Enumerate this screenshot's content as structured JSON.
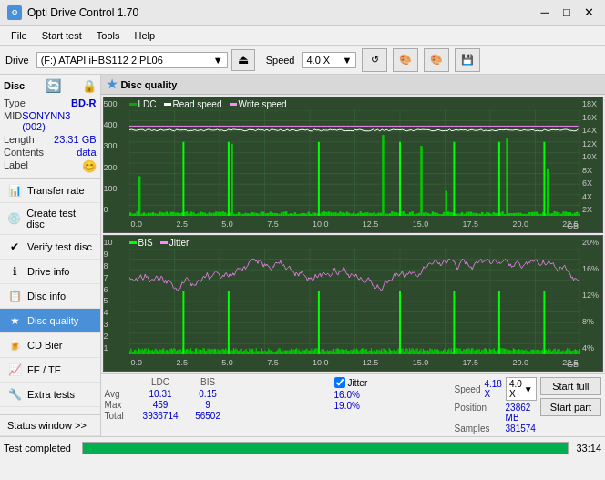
{
  "app": {
    "title": "Opti Drive Control 1.70",
    "icon": "O"
  },
  "titlebar": {
    "minimize": "─",
    "maximize": "□",
    "close": "✕"
  },
  "menubar": {
    "items": [
      "File",
      "Start test",
      "Tools",
      "Help"
    ]
  },
  "toolbar": {
    "drive_label": "Drive",
    "drive_value": "(F:)  ATAPI  iHBS112  2 PL06",
    "speed_label": "Speed",
    "speed_value": "4.0 X"
  },
  "disc": {
    "title": "Disc",
    "type_label": "Type",
    "type_value": "BD-R",
    "mid_label": "MID",
    "mid_value": "SONYNN3 (002)",
    "length_label": "Length",
    "length_value": "23.31 GB",
    "contents_label": "Contents",
    "contents_value": "data",
    "label_label": "Label",
    "label_value": ""
  },
  "nav": {
    "items": [
      {
        "id": "transfer-rate",
        "label": "Transfer rate",
        "icon": "📊"
      },
      {
        "id": "create-test-disc",
        "label": "Create test disc",
        "icon": "💿"
      },
      {
        "id": "verify-test-disc",
        "label": "Verify test disc",
        "icon": "✔"
      },
      {
        "id": "drive-info",
        "label": "Drive info",
        "icon": "ℹ"
      },
      {
        "id": "disc-info",
        "label": "Disc info",
        "icon": "📋"
      },
      {
        "id": "disc-quality",
        "label": "Disc quality",
        "icon": "★",
        "active": true
      },
      {
        "id": "cd-bier",
        "label": "CD Bier",
        "icon": "🍺"
      },
      {
        "id": "fe-te",
        "label": "FE / TE",
        "icon": "📈"
      },
      {
        "id": "extra-tests",
        "label": "Extra tests",
        "icon": "🔧"
      }
    ]
  },
  "quality": {
    "title": "Disc quality",
    "legend": {
      "ldc": "LDC",
      "read_speed": "Read speed",
      "write_speed": "Write speed"
    },
    "chart1": {
      "y_axis": [
        "500",
        "400",
        "300",
        "200",
        "100",
        "0"
      ],
      "y_axis_right": [
        "18X",
        "16X",
        "14X",
        "12X",
        "10X",
        "8X",
        "6X",
        "4X",
        "2X"
      ],
      "x_axis": [
        "0.0",
        "2.5",
        "5.0",
        "7.5",
        "10.0",
        "12.5",
        "15.0",
        "17.5",
        "20.0",
        "22.5"
      ],
      "x_unit": "GB"
    },
    "chart2": {
      "legend": [
        "BIS",
        "Jitter"
      ],
      "y_axis": [
        "10",
        "9",
        "8",
        "7",
        "6",
        "5",
        "4",
        "3",
        "2",
        "1"
      ],
      "y_axis_right": [
        "20%",
        "16%",
        "12%",
        "8%",
        "4%"
      ],
      "x_axis": [
        "0.0",
        "2.5",
        "5.0",
        "7.5",
        "10.0",
        "12.5",
        "15.0",
        "17.5",
        "20.0",
        "22.5"
      ],
      "x_unit": "GB"
    }
  },
  "stats": {
    "headers": [
      "",
      "LDC",
      "BIS",
      "",
      "Jitter",
      "Speed"
    ],
    "avg_label": "Avg",
    "avg_ldc": "10.31",
    "avg_bis": "0.15",
    "avg_jitter": "16.0%",
    "avg_speed": "4.18 X",
    "max_label": "Max",
    "max_ldc": "459",
    "max_bis": "9",
    "max_jitter": "19.0%",
    "total_label": "Total",
    "total_ldc": "3936714",
    "total_bis": "56502",
    "speed_select": "4.0 X",
    "position_label": "Position",
    "position_value": "23862 MB",
    "samples_label": "Samples",
    "samples_value": "381574",
    "jitter_label": "Jitter",
    "jitter_checked": true,
    "start_full": "Start full",
    "start_part": "Start part"
  },
  "statusbar": {
    "status_text": "Test completed",
    "progress": 100,
    "time": "33:14"
  }
}
